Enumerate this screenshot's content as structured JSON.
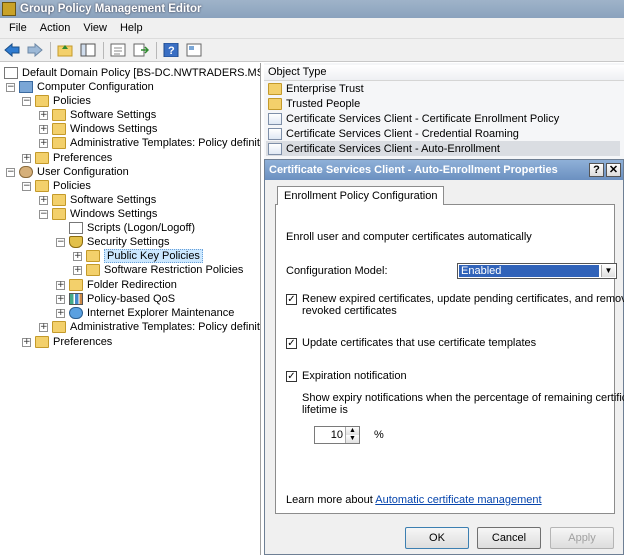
{
  "window": {
    "title": "Group Policy Management Editor"
  },
  "menu": {
    "file": "File",
    "action": "Action",
    "view": "View",
    "help": "Help"
  },
  "toolbar": {
    "icons": [
      "back-arrow-icon",
      "forward-arrow-icon",
      "up-folder-icon",
      "show-hide-tree-icon",
      "refresh-icon",
      "export-list-icon",
      "help-icon",
      "properties-icon"
    ]
  },
  "tree": {
    "root": "Default Domain Policy [BS-DC.NWTRADERS.MSFT] Polic",
    "computer_configuration": "Computer Configuration",
    "cc_policies": "Policies",
    "cc_software_settings": "Software Settings",
    "cc_windows_settings": "Windows Settings",
    "cc_admin_templates": "Administrative Templates: Policy definitions",
    "cc_preferences": "Preferences",
    "user_configuration": "User Configuration",
    "uc_policies": "Policies",
    "uc_software_settings": "Software Settings",
    "uc_windows_settings": "Windows Settings",
    "uc_scripts": "Scripts (Logon/Logoff)",
    "uc_security_settings": "Security Settings",
    "uc_public_key_policies": "Public Key Policies",
    "uc_software_restriction": "Software Restriction Policies",
    "uc_folder_redirection": "Folder Redirection",
    "uc_policy_qos": "Policy-based QoS",
    "uc_ie_maintenance": "Internet Explorer Maintenance",
    "uc_admin_templates": "Administrative Templates: Policy definitions",
    "uc_preferences": "Preferences"
  },
  "list": {
    "header": "Object Type",
    "items": [
      "Enterprise Trust",
      "Trusted People",
      "Certificate Services Client - Certificate Enrollment Policy",
      "Certificate Services Client - Credential Roaming",
      "Certificate Services Client - Auto-Enrollment"
    ]
  },
  "dialog": {
    "title": "Certificate Services Client - Auto-Enrollment Properties",
    "help_btn": "?",
    "close_btn": "✕",
    "tab": "Enrollment Policy Configuration",
    "intro": "Enroll user and computer certificates automatically",
    "config_model_label": "Configuration Model:",
    "config_model_value": "Enabled",
    "renew_line1": "Renew expired certificates, update pending certificates, and remove",
    "renew_line2": "revoked certificates",
    "renew_checked": "✓",
    "update_label": "Update certificates that use certificate templates",
    "update_checked": "✓",
    "expiration_label": "Expiration notification",
    "expiration_checked": "✓",
    "expiry_line1": "Show expiry notifications when the percentage of remaining certificate",
    "expiry_line2": "lifetime is",
    "expiry_value": "10",
    "percent": "%",
    "learn_more": "Learn more about",
    "learn_link": "Automatic certificate management",
    "ok": "OK",
    "cancel": "Cancel",
    "apply": "Apply"
  }
}
